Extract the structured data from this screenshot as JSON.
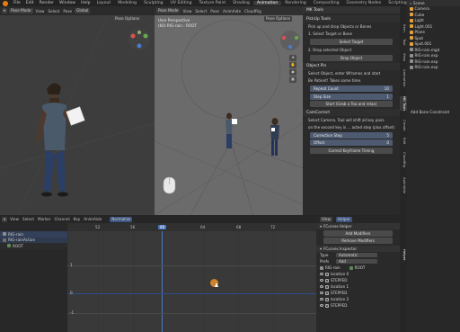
{
  "menu": [
    "File",
    "Edit",
    "Render",
    "Window",
    "Help"
  ],
  "workspaces": [
    "Layout",
    "Modeling",
    "Sculpting",
    "UV Editing",
    "Texture Paint",
    "Shading",
    "Animation",
    "Rendering",
    "Compositing",
    "Geometry Nodes",
    "Scripting"
  ],
  "left_view": {
    "mode": "Pose Mode",
    "view": "View",
    "select": "Select",
    "pose": "Pose",
    "transform": "Global",
    "options": "Pose Options"
  },
  "center_view": {
    "mode": "Pose Mode",
    "view": "View",
    "select": "Select",
    "pose": "Pose",
    "animate": "AnimAide",
    "clouddig": "CloudRig",
    "transform": "Global",
    "options": "Pose Options",
    "perspective": "User Perspective",
    "object": "(60) RIG-rain : ROOT"
  },
  "npanel": {
    "title": "MK Tools",
    "pickup": {
      "header": "PickUp Tools",
      "step0": "Pick up and drop Objects or Bones",
      "step1": "1. Select Target or Bone",
      "select_target": "Select Target",
      "step2": "2. Drop selected Object",
      "drop_object": "Drop Object"
    },
    "objectpin": {
      "header": "Object Pin",
      "desc1": "Select Object, enter Wframes and start",
      "desc2": "Be Patient! Takes some time.",
      "repeat_label": "Repeat Count",
      "repeat_value": "10",
      "step_label": "Step Size",
      "step_value": "1",
      "start_button": "Start (Grab a Tea and relax)"
    },
    "camcorrect": {
      "header": "CamCorrect",
      "desc1": "Select Camera. Tool will shift all key pairs",
      "desc2": "on the second key is ... acted step (plus offset)",
      "correction_label": "Correction Step",
      "correction_value": "5",
      "offset_label": "Offset",
      "offset_value": "0",
      "button": "Correct Keyframe Timing"
    }
  },
  "outliner": {
    "search_label": "Scene",
    "items": [
      "Camera",
      "Cube",
      "Light",
      "Light.001",
      "Plane",
      "Spot",
      "Spot.001",
      "RIG-rain.mgd",
      "RIG-rain.exp",
      "RIG-rain.exp",
      "RIG-rain.exp"
    ],
    "add_constraint": "Add Bone Constraint"
  },
  "tabs": [
    "Item",
    "Tool",
    "View",
    "Animation",
    "MK Tools",
    "Create",
    "Edit",
    "CloudRig",
    "AnimAide",
    "Helper"
  ],
  "graph_editor": {
    "menu": [
      "View",
      "Select",
      "Marker",
      "Channel",
      "Key",
      "AnimAide"
    ],
    "normalize": "Normalize",
    "frames": [
      "48",
      "52",
      "56",
      "60",
      "64",
      "68",
      "72"
    ],
    "current_frame": "60",
    "y_labels": [
      "1",
      "0",
      "-1"
    ],
    "channels": [
      "RIG-rain",
      "RIG-rainAction",
      "ROOT"
    ]
  },
  "fcurves": {
    "tab1": "View",
    "tab2": "Helper",
    "helper_header": "FCurves Helper",
    "add_modifiers": "Add Modifiers",
    "remove_modifiers": "Remove Modifiers",
    "inspector_header": "FCurves Inspector",
    "type_label": "Type",
    "type_value": "Automatic",
    "prefs_label": "Prefs",
    "prefs_value": "Add",
    "rig": "RIG-rain",
    "bone": "ROOT",
    "rows": [
      "location 0",
      "STEPPED",
      "location 1",
      "STEPPED",
      "location 2",
      "STEPPED"
    ]
  }
}
